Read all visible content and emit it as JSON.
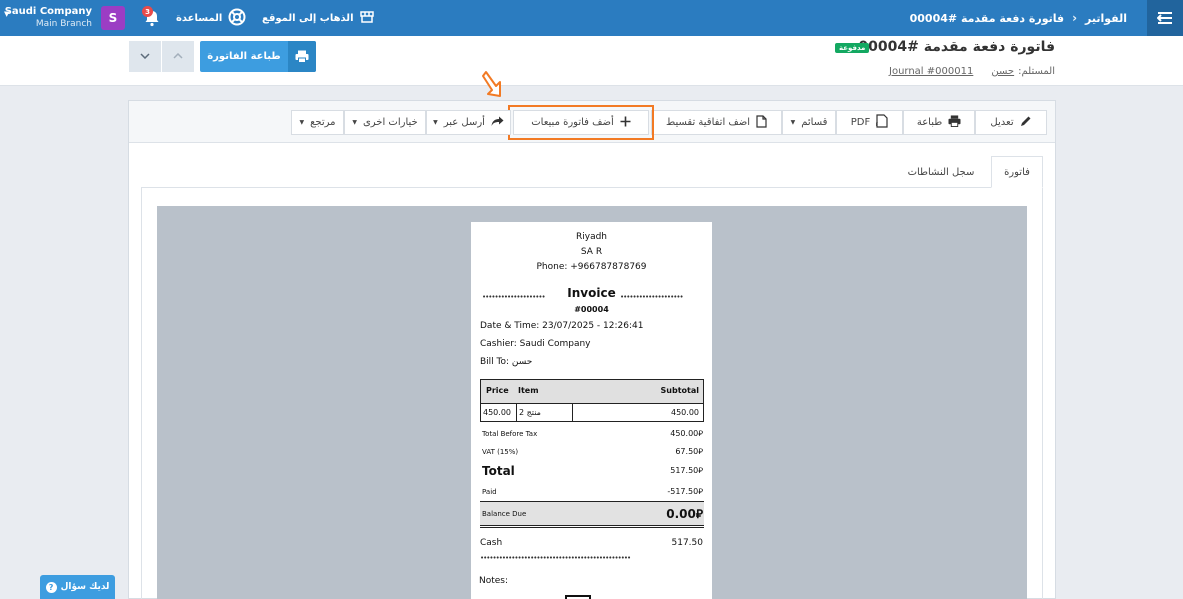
{
  "topbar": {
    "breadcrumb_root": "الفواتير",
    "breadcrumb_current": "فاتورة دفعة مقدمة #00004",
    "goto_site": "الذهاب إلى الموقع",
    "help": "المساعدة",
    "notifications_count": "3",
    "avatar_letter": "S",
    "company": "Saudi Company",
    "branch": "Main Branch"
  },
  "header": {
    "title": "فاتورة دفعة مقدمة #00004",
    "status_badge": "مدفوعة",
    "recipient_label": "المستلم:",
    "recipient_name": "حسن",
    "journal_link": "Journal #000011",
    "print_button": "طباعة الفاتورة"
  },
  "toolbar": {
    "edit": "تعديل",
    "print": "طباعة",
    "pdf": "PDF",
    "lists": "قسائم",
    "installment": "اضف اتفاقية تقسيط",
    "add_sales_invoice": "أضف فاتورة مبيعات",
    "send_via": "أرسل عبر",
    "other_options": "خيارات اخرى",
    "return": "مرتجع"
  },
  "tabs": {
    "invoice": "فاتورة",
    "activity_log": "سجل النشاطات"
  },
  "receipt": {
    "city": "Riyadh",
    "country": "SA R",
    "phone": "Phone: +966787878769",
    "dots": "••••••••••••••••••••",
    "title": "Invoice",
    "number": "#00004",
    "datetime": "Date & Time: 23/07/2025 - 12:26:41",
    "cashier": "Cashier: Saudi Company",
    "bill_to": "Bill To: حسن",
    "col_price": "Price",
    "col_item": "Item",
    "col_subtotal": "Subtotal",
    "row_price": "450.00",
    "row_item": "منتج 2",
    "row_subtotal": "450.00",
    "before_tax_label": "Total Before Tax",
    "before_tax_value": "450.00⃁",
    "vat_label": "VAT (15%)",
    "vat_value": "67.50⃁",
    "total_label": "Total",
    "total_value": "517.50⃁",
    "paid_label": "Paid",
    "paid_value": "-517.50⃁",
    "balance_label": "Balance Due",
    "balance_value": "0.00⃁",
    "cash_label": "Cash",
    "cash_value": "517.50",
    "dots_long": "••••••••••••••••••••••••••••••••••••••••••••••••",
    "notes_label": "Notes:"
  },
  "help_float": "لديك سؤال",
  "colors": {
    "topbar": "#2b7cc0",
    "primary_button": "#3d9de0",
    "paid_badge": "#13a861",
    "highlight": "#f27a24"
  }
}
